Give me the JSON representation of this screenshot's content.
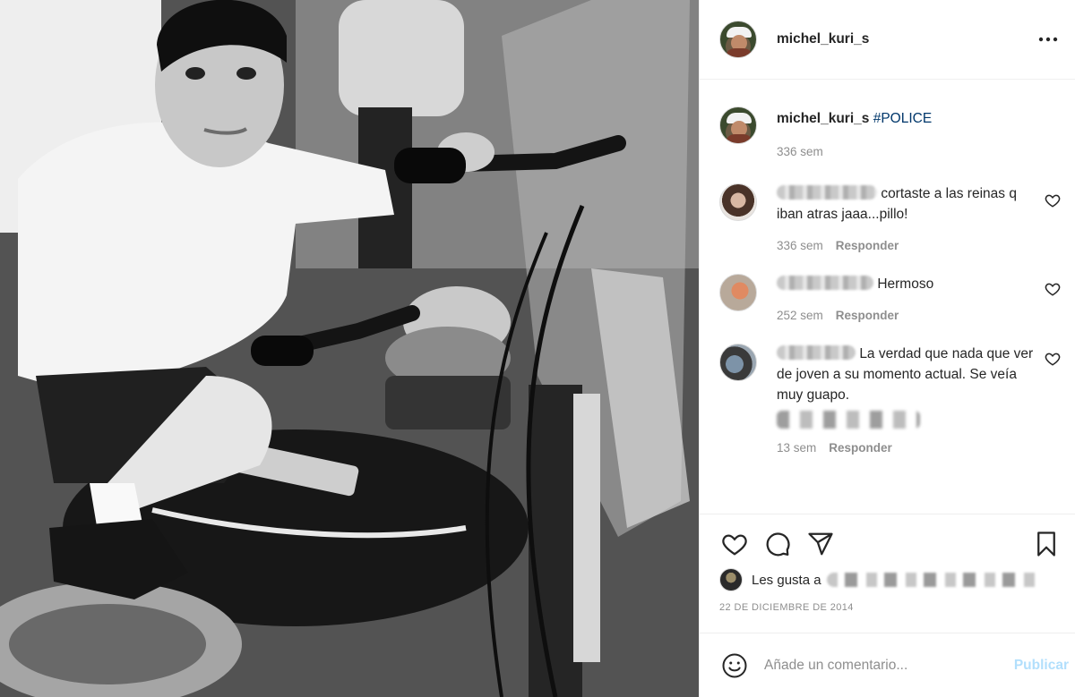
{
  "post": {
    "username": "michel_kuri_s",
    "more_icon": "more-horizontal-icon"
  },
  "caption": {
    "username": "michel_kuri_s",
    "text": "#POLICE",
    "time": "336 sem"
  },
  "comments": [
    {
      "text": "cortaste a las reinas q iban atras jaaa...pillo!",
      "time": "336 sem",
      "reply_label": "Responder"
    },
    {
      "text": "Hermoso",
      "time": "252 sem",
      "reply_label": "Responder"
    },
    {
      "text": "La verdad que nada que ver de joven a su momento actual. Se veía muy guapo.",
      "time": "13 sem",
      "reply_label": "Responder"
    }
  ],
  "actions": {
    "like_icon": "heart-icon",
    "comment_icon": "comment-icon",
    "share_icon": "share-icon",
    "save_icon": "bookmark-icon"
  },
  "likes": {
    "prefix": "Les gusta a"
  },
  "date": "22 DE DICIEMBRE DE 2014",
  "comment_box": {
    "placeholder": "Añade un comentario...",
    "publish_label": "Publicar",
    "emoji_icon": "smiley-icon"
  },
  "colors": {
    "link": "#00376b",
    "muted": "#8e8e8e",
    "publish_disabled": "#b2dffc",
    "border": "#efefef"
  }
}
